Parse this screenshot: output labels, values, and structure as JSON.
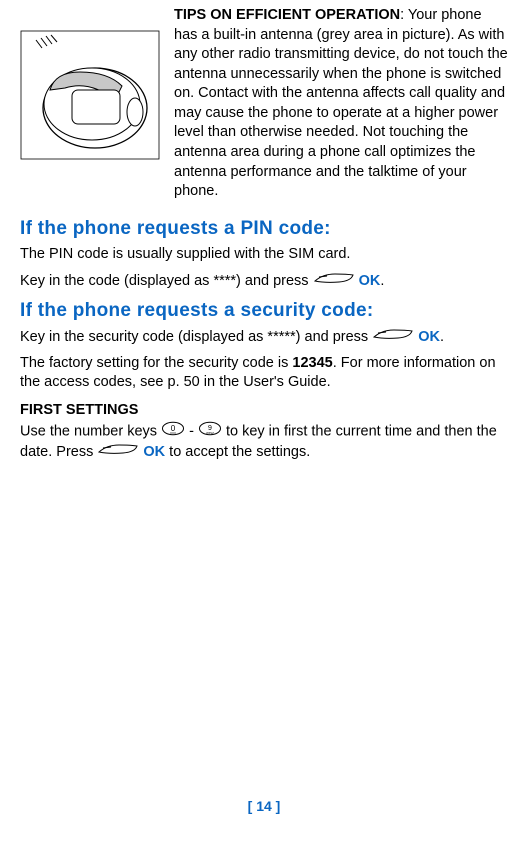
{
  "tips": {
    "label": "TIPS ON EFFICIENT OPERATION",
    "body": ": Your phone has a built-in antenna (grey area in picture). As with any other radio transmitting device, do not touch the antenna unnecessarily when the phone is switched on. Contact with the antenna affects call quality and may cause the phone to operate at a higher power level than otherwise needed. Not touching the antenna area during a phone call optimizes the antenna performance and the talktime of your phone."
  },
  "pin": {
    "heading": "If the phone requests a PIN code:",
    "line1": "The PIN code is usually supplied with the SIM card.",
    "line2_pre": "Key in the code (displayed as ****) and press ",
    "ok": "OK",
    "line2_post": "."
  },
  "security": {
    "heading": "If the phone requests a security code:",
    "line1_pre": "Key in the security code (displayed as *****) and press ",
    "ok": "OK",
    "line1_post": ".",
    "line2_pre": "The factory setting for the security code is ",
    "line2_bold": "12345",
    "line2_post": ". For more information on the access codes, see p. 50 in the User's Guide."
  },
  "first_settings": {
    "heading": "FIRST SETTINGS",
    "line_pre": "Use the number keys ",
    "dash": " - ",
    "mid": " to key in first the current time and then the date. Press ",
    "ok": "OK",
    "post": " to accept the settings.",
    "key0": "0",
    "key9": "9"
  },
  "footer": {
    "page": "[ 14 ]"
  }
}
